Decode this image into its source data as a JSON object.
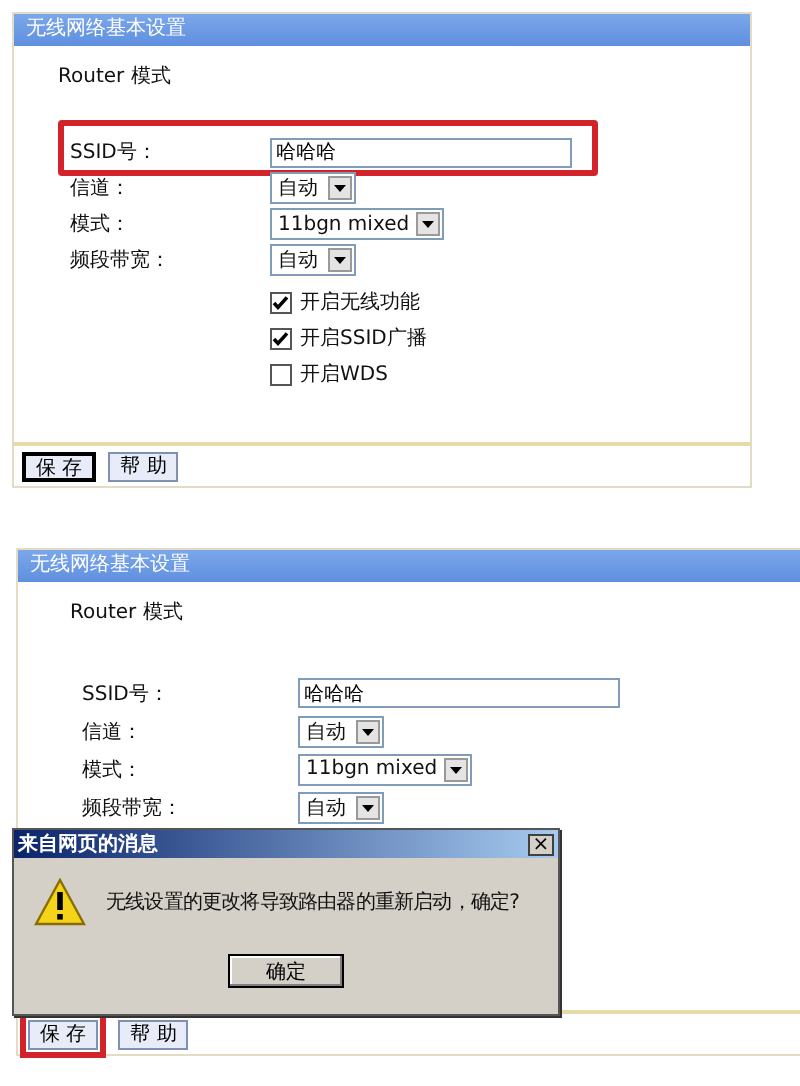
{
  "panels": [
    {
      "title": "无线网络基本设置",
      "mode": "Router 模式",
      "fields": [
        {
          "kind": "text",
          "label": "SSID号：",
          "value": "哈哈哈",
          "highlighted": true
        },
        {
          "kind": "select",
          "label": "信道：",
          "value": "自动",
          "highlighted": false
        },
        {
          "kind": "select",
          "label": "模式：",
          "value": "11bgn mixed",
          "highlighted": false
        },
        {
          "kind": "select",
          "label": "频段带宽：",
          "value": "自动",
          "highlighted": false
        }
      ],
      "checkboxes": [
        {
          "label": "开启无线功能",
          "checked": true
        },
        {
          "label": "开启SSID广播",
          "checked": true
        },
        {
          "label": "开启WDS",
          "checked": false
        }
      ],
      "buttons": [
        {
          "label": "保 存",
          "focused": true,
          "highlighted": false
        },
        {
          "label": "帮 助",
          "focused": false,
          "highlighted": false
        }
      ]
    },
    {
      "title": "无线网络基本设置",
      "mode": "Router 模式",
      "fields": [
        {
          "kind": "text",
          "label": "SSID号：",
          "value": "哈哈哈",
          "highlighted": false
        },
        {
          "kind": "select",
          "label": "信道：",
          "value": "自动",
          "highlighted": false
        },
        {
          "kind": "select",
          "label": "模式：",
          "value": "11bgn mixed",
          "highlighted": false
        },
        {
          "kind": "select",
          "label": "频段带宽：",
          "value": "自动",
          "highlighted": false
        }
      ],
      "buttons": [
        {
          "label": "保 存",
          "focused": false,
          "highlighted": true
        },
        {
          "label": "帮 助",
          "focused": false,
          "highlighted": false
        }
      ],
      "dialog": {
        "title": "来自网页的消息",
        "close": "×",
        "message": "无线设置的更改将导致路由器的重新启动，确定?",
        "button": "确定"
      }
    }
  ]
}
